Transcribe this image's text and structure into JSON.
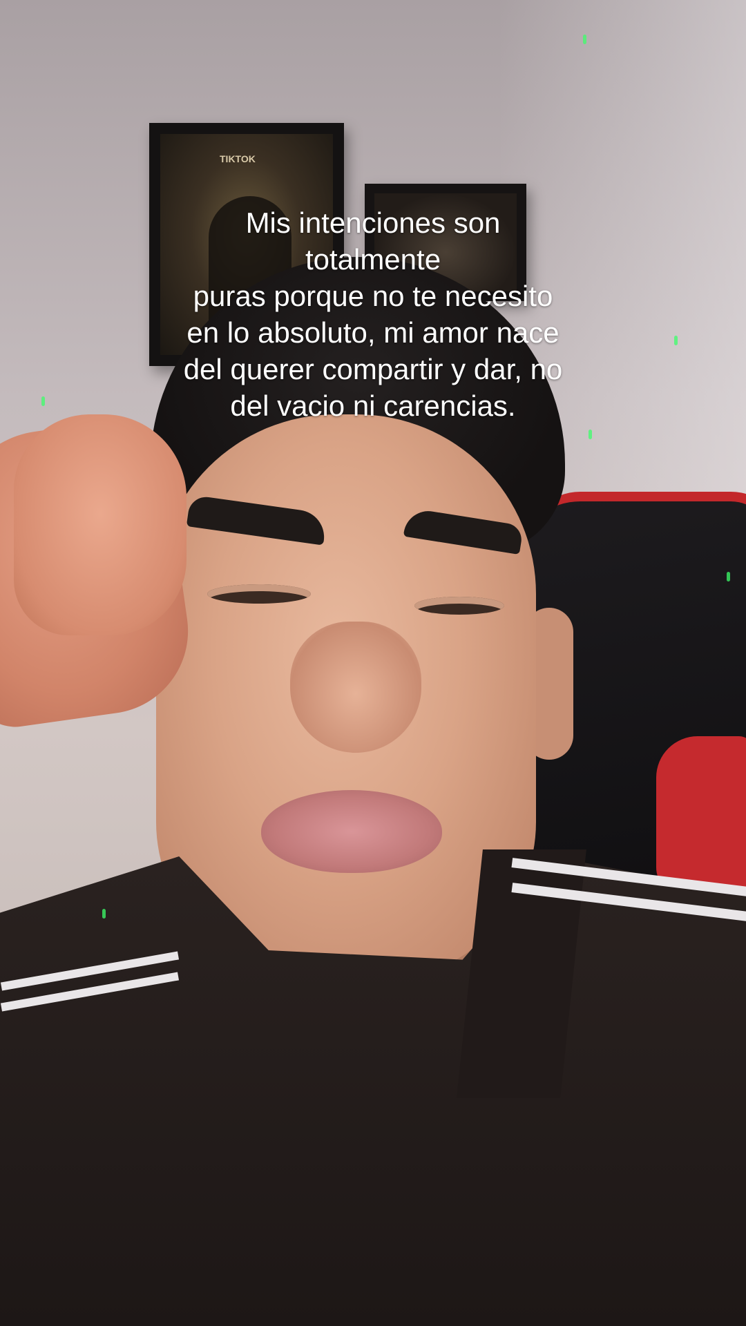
{
  "overlay": {
    "caption": "Mis intenciones son\ntotalmente\npuras porque no te necesito\nen lo absoluto, mi amor nace\ndel querer compartir y dar, no\ndel vacio ni carencias.",
    "frame_label": "TIKTOK"
  },
  "colors": {
    "caption_text": "#ffffff",
    "chair_accent": "#c52a2e",
    "laser_dots": "#3cff6a"
  }
}
